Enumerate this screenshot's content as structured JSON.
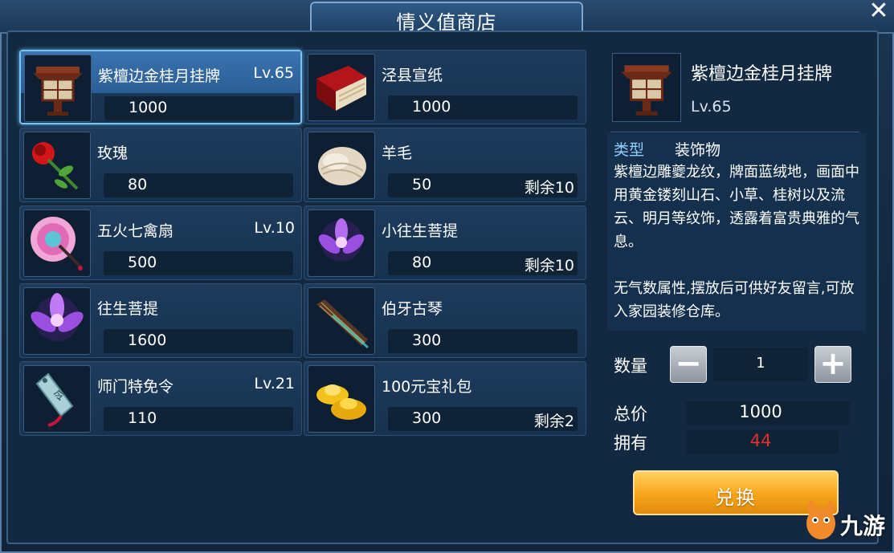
{
  "shop": {
    "title": "情义值商店"
  },
  "items": [
    {
      "name": "紫檀边金桂月挂牌",
      "level": "Lv.65",
      "price": "1000",
      "remain": "",
      "icon": "lantern-plaque-icon"
    },
    {
      "name": "泾县宣纸",
      "level": "",
      "price": "1000",
      "remain": "",
      "icon": "paper-box-icon"
    },
    {
      "name": "玫瑰",
      "level": "",
      "price": "80",
      "remain": "",
      "icon": "rose-icon"
    },
    {
      "name": "羊毛",
      "level": "",
      "price": "50",
      "remain": "剩余10",
      "icon": "wool-icon"
    },
    {
      "name": "五火七禽扇",
      "level": "Lv.10",
      "price": "500",
      "remain": "",
      "icon": "feather-fan-icon"
    },
    {
      "name": "小往生菩提",
      "level": "",
      "price": "80",
      "remain": "剩余10",
      "icon": "purple-flower-icon"
    },
    {
      "name": "往生菩提",
      "level": "",
      "price": "1600",
      "remain": "",
      "icon": "purple-flower-icon"
    },
    {
      "name": "伯牙古琴",
      "level": "",
      "price": "300",
      "remain": "",
      "icon": "guqin-icon"
    },
    {
      "name": "师门特免令",
      "level": "Lv.21",
      "price": "110",
      "remain": "",
      "icon": "token-tag-icon"
    },
    {
      "name": "100元宝礼包",
      "level": "",
      "price": "300",
      "remain": "剩余2",
      "icon": "gold-ingot-icon"
    }
  ],
  "detail": {
    "name": "紫檀边金桂月挂牌",
    "level": "Lv.65",
    "type_label": "类型",
    "type_value": "装饰物",
    "description": "紫檀边雕夔龙纹，牌面蓝绒地，画面中用黄金镂刻山石、小草、桂树以及流云、明月等纹饰，透露着富贵典雅的气息。",
    "description2": "无气数属性,摆放后可供好友留言,可放入家园装修仓库。"
  },
  "purchase": {
    "quantity_label": "数量",
    "quantity": "1",
    "total_label": "总价",
    "total": "1000",
    "owned_label": "拥有",
    "owned": "44",
    "owned_color": "#e0302a",
    "exchange_label": "兑换"
  },
  "watermark": {
    "text": "九游"
  },
  "colors": {
    "selected_border": "#7ec3f0",
    "button_orange": "#f7a51a"
  }
}
